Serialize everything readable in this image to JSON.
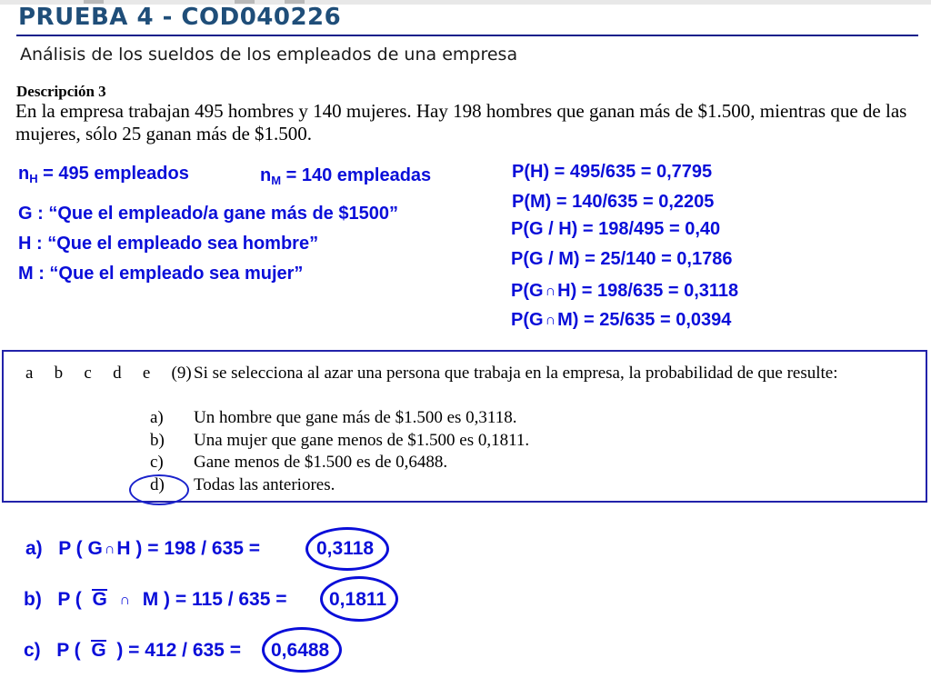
{
  "header": {
    "title": "PRUEBA 4 - COD040226",
    "subtitle": "Análisis de los sueldos de los empleados de una empresa"
  },
  "description": {
    "heading": "Descripción 3",
    "text": "En la empresa trabajan 495 hombres y 140 mujeres. Hay 198 hombres que ganan más de $1.500, mientras que de las mujeres, sólo 25 ganan más de $1.500."
  },
  "definitions": {
    "nH_sub": "H",
    "nH_value": " = 495 empleados",
    "nM_sub": "M",
    "nM_value": " = 140 empleadas",
    "events": [
      "G : “Que el empleado/a gane más de $1500”",
      "H : “Que el empleado sea hombre”",
      "M : “Que el empleado sea mujer”"
    ]
  },
  "probabilities": [
    "P(H) = 495/635 = 0,7795",
    "P(M) = 140/635 = 0,2205",
    "P(G / H) = 198/495 = 0,40",
    "P(G / M) = 25/140 = 0,1786",
    {
      "pre": "P(G",
      "post": "H) = 198/635 = 0,3118"
    },
    {
      "pre": "P(G",
      "post": "M) = 25/635 = 0,0394"
    }
  ],
  "question": {
    "choices_row": "a   b   c   d   e   (9)",
    "stem": "Si se selecciona al azar una persona que trabaja en la empresa, la probabilidad de que resulte:",
    "options": [
      {
        "letter": "a)",
        "text": "Un hombre que gane más de $1.500 es 0,3118."
      },
      {
        "letter": "b)",
        "text": "Una mujer que gane menos de $1.500 es 0,1811."
      },
      {
        "letter": "c)",
        "text": "Gane menos de $1.500 es de 0,6488."
      },
      {
        "letter": "d)",
        "text": "Todas las anteriores."
      }
    ],
    "selected": "d)"
  },
  "answers": [
    {
      "label": "a)",
      "expr_pre": "P ( G",
      "expr_post": "H )  =  198 / 635 =",
      "result": "0,3118"
    },
    {
      "label": "b)",
      "expr_pre": "P (",
      "g": "G",
      "expr_post": "M ) =  115 / 635 =",
      "result": "0,1811"
    },
    {
      "label": "c)",
      "expr_pre": "P (",
      "g": "G",
      "expr_post": ") =  412 / 635 =",
      "result": "0,6488"
    }
  ],
  "colors": {
    "title": "#1f4e79",
    "accent_blue": "#0a0ed9",
    "rule": "#0c1f8a"
  }
}
